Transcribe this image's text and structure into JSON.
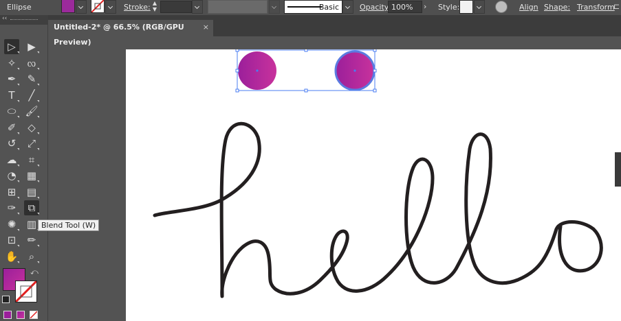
{
  "control_bar": {
    "selection_type": "Ellipse",
    "fill_color": "#9b2a9b",
    "stroke_label": "Stroke:",
    "stroke_weight": "",
    "brush_profile": "Basic",
    "opacity_label": "Opacity:",
    "opacity_value": "100%",
    "style_label": "Style:",
    "align_label": "Align",
    "shape_label": "Shape:",
    "transform_label": "Transform"
  },
  "document_tab": {
    "title": "Untitled-2* @ 66.5% (RGB/GPU Preview)",
    "close": "×"
  },
  "tools": {
    "collapse": "‹‹",
    "tooltip": "Blend Tool (W)",
    "items": [
      {
        "name": "selection-tool-icon",
        "glyph": "▷"
      },
      {
        "name": "direct-selection-tool-icon",
        "glyph": "▶"
      },
      {
        "name": "magic-wand-tool-icon",
        "glyph": "✧"
      },
      {
        "name": "lasso-tool-icon",
        "glyph": "ᦟ"
      },
      {
        "name": "pen-tool-icon",
        "glyph": "✒"
      },
      {
        "name": "curvature-tool-icon",
        "glyph": "✎"
      },
      {
        "name": "type-tool-icon",
        "glyph": "T"
      },
      {
        "name": "line-segment-tool-icon",
        "glyph": "╱"
      },
      {
        "name": "ellipse-tool-icon",
        "glyph": "⬭"
      },
      {
        "name": "paintbrush-tool-icon",
        "glyph": "🖌"
      },
      {
        "name": "shaper-tool-icon",
        "glyph": "✐"
      },
      {
        "name": "eraser-tool-icon",
        "glyph": "◇"
      },
      {
        "name": "rotate-tool-icon",
        "glyph": "↺"
      },
      {
        "name": "scale-tool-icon",
        "glyph": "⤢"
      },
      {
        "name": "warp-tool-icon",
        "glyph": "☁"
      },
      {
        "name": "free-transform-tool-icon",
        "glyph": "⌗"
      },
      {
        "name": "shape-builder-tool-icon",
        "glyph": "◔"
      },
      {
        "name": "perspective-grid-tool-icon",
        "glyph": "▦"
      },
      {
        "name": "mesh-tool-icon",
        "glyph": "⊞"
      },
      {
        "name": "gradient-tool-icon",
        "glyph": "▤"
      },
      {
        "name": "eyedropper-tool-icon",
        "glyph": "✑"
      },
      {
        "name": "blend-tool-icon",
        "glyph": "⧉"
      },
      {
        "name": "symbol-sprayer-tool-icon",
        "glyph": "✺"
      },
      {
        "name": "column-graph-tool-icon",
        "glyph": "▥"
      },
      {
        "name": "artboard-tool-icon",
        "glyph": "⊡"
      },
      {
        "name": "slice-tool-icon",
        "glyph": "✏"
      },
      {
        "name": "hand-tool-icon",
        "glyph": "✋"
      },
      {
        "name": "zoom-tool-icon",
        "glyph": "⌕"
      }
    ]
  },
  "colors": {
    "fill_gradient_start": "#9b1f9b",
    "fill_gradient_end": "#c8329c",
    "circle_stroke": "#5b7be0",
    "selection_blue": "#4a7cf2",
    "hello_stroke": "#231f20"
  }
}
